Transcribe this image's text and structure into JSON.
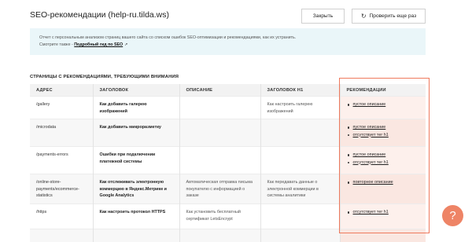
{
  "header": {
    "title": "SEO-рекомендации (help-ru.tilda.ws)",
    "close_label": "Закрыть",
    "recheck_label": "Проверить еще раз",
    "recheck_icon": "refresh-icon"
  },
  "info": {
    "text": "Отчет с персональным анализом страниц вашего сайта со списком ошибок SEO-оптимизации и рекомендациями, как их устранить.",
    "see_also": "Смотрите также -",
    "link": "Подробный гид по SEO",
    "link_icon": "external-link-icon"
  },
  "section_title": "СТРАНИЦЫ С РЕКОМЕНДАЦИЯМИ, ТРЕБУЮЩИМИ ВНИМАНИЯ",
  "table": {
    "headers": [
      "АДРЕС",
      "ЗАГОЛОВОК",
      "ОПИСАНИЕ",
      "ЗАГОЛОВОК H1",
      "РЕКОМЕНДАЦИИ"
    ],
    "rows": [
      {
        "address": "/gallery",
        "heading": "Как добавить галерею изображений",
        "description": "",
        "h1": "Как настроить галерею изображений",
        "recs": [
          "пустое описание"
        ]
      },
      {
        "address": "/microdata",
        "heading": "Как добавить микроразметку",
        "description": "",
        "h1": "",
        "recs": [
          "пустое описание",
          "отсутствует тег h1"
        ]
      },
      {
        "address": "/payments-errors",
        "heading": "Ошибки при подключении платежной системы",
        "description": "",
        "h1": "",
        "recs": [
          "пустое описание",
          "отсутствует тег h1"
        ]
      },
      {
        "address": "/online-store-payments/ecommerce-statistics",
        "heading": "Как отслеживать электронную коммерцию в Яндекс.Метрике и Google Analytics",
        "description": "Автоматическая отправка письма покупателю с информацией о заказе",
        "h1": "Как передавать данные о электронной коммерции в системы аналитики",
        "recs": [
          "повторное описание"
        ]
      },
      {
        "address": "/https",
        "heading": "Как настроить протокол HTTPS",
        "description": "Как установить бесплатный сертификат LetsEncrypt",
        "h1": "",
        "recs": [
          "отсутствует тег h1"
        ]
      }
    ]
  },
  "help_button": {
    "label": "?",
    "icon": "question-icon"
  },
  "colors": {
    "accent": "#ef7a5e",
    "info_bg": "#eaf6f9",
    "help": "#ee8466"
  }
}
